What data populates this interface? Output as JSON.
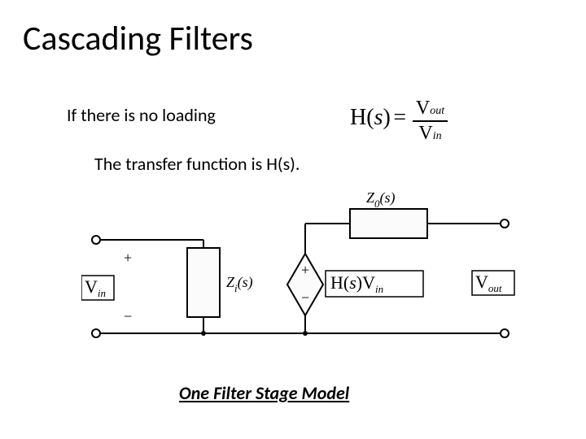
{
  "title": "Cascading Filters",
  "line1": "If there is no loading",
  "line2": "The transfer function is H(s).",
  "caption": "One Filter Stage Model",
  "equation": {
    "lhs_fn": "H",
    "lhs_arg": "s",
    "equals": "=",
    "num_sym": "V",
    "num_sub": "out",
    "den_sym": "V",
    "den_sub": "in"
  },
  "circuit": {
    "vin_sym": "V",
    "vin_sub": "in",
    "vout_sym": "V",
    "vout_sub": "out",
    "zi": "Z",
    "zi_arg": "(s)",
    "zi_sub": "i",
    "zo": "Z",
    "zo_arg": "(s)",
    "zo_sub": "0",
    "src_sym_h": "H",
    "src_arg": "s",
    "src_vin_sym": "V",
    "src_vin_sub": "in",
    "plus": "+",
    "minus": "−"
  }
}
